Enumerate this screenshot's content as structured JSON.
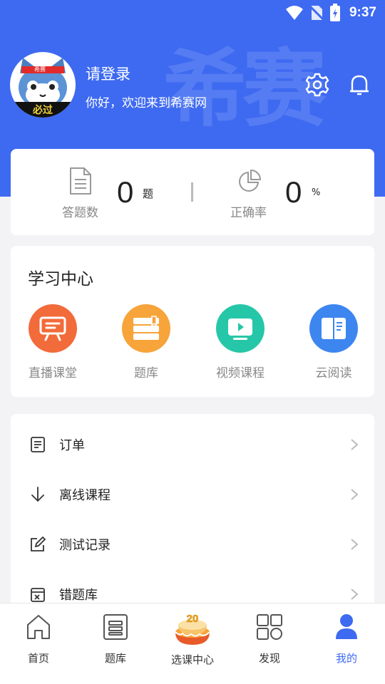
{
  "status_bar": {
    "time": "9:37"
  },
  "header": {
    "watermark": "希赛",
    "login_text": "请登录",
    "welcome_text": "你好，欢迎来到希赛网",
    "avatar": {
      "cap_text": "希赛",
      "badge_text": "必过"
    }
  },
  "stats": {
    "answered": {
      "label": "答题数",
      "value": "0",
      "unit": "题"
    },
    "accuracy": {
      "label": "正确率",
      "value": "0",
      "unit": "%"
    }
  },
  "study_center": {
    "title": "学习中心",
    "items": [
      {
        "label": "直播课堂",
        "icon": "live-board-icon",
        "color": "#f26b3a"
      },
      {
        "label": "题库",
        "icon": "question-bank-icon",
        "color": "#f7a43a"
      },
      {
        "label": "视频课程",
        "icon": "video-play-icon",
        "color": "#26c7a8"
      },
      {
        "label": "云阅读",
        "icon": "book-icon",
        "color": "#3d86f0"
      }
    ]
  },
  "menu": [
    {
      "label": "订单",
      "icon": "order-icon"
    },
    {
      "label": "离线课程",
      "icon": "download-icon"
    },
    {
      "label": "测试记录",
      "icon": "edit-icon"
    },
    {
      "label": "错题库",
      "icon": "error-bank-icon"
    }
  ],
  "tabbar": [
    {
      "label": "首页",
      "icon": "home-icon",
      "active": false
    },
    {
      "label": "题库",
      "icon": "list-icon",
      "active": false
    },
    {
      "label": "选课中心",
      "icon": "cake-icon",
      "badge": "20",
      "active": false
    },
    {
      "label": "发现",
      "icon": "discover-icon",
      "active": false
    },
    {
      "label": "我的",
      "icon": "user-icon",
      "active": true
    }
  ],
  "colors": {
    "brand": "#3e6af1",
    "background": "#f3f3f5"
  }
}
